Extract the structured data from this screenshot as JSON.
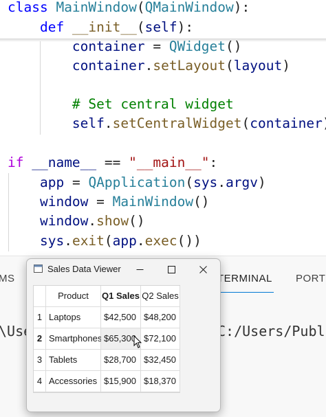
{
  "editor": {
    "lines": [
      {
        "tokens": [
          {
            "t": "class ",
            "c": "kw"
          },
          {
            "t": "MainWindow",
            "c": "cls"
          },
          {
            "t": "(",
            "c": "plain"
          },
          {
            "t": "QMainWindow",
            "c": "cls"
          },
          {
            "t": "):",
            "c": "plain"
          }
        ]
      },
      {
        "tokens": [
          {
            "t": "    ",
            "c": "plain"
          },
          {
            "t": "def ",
            "c": "kw"
          },
          {
            "t": "__init__",
            "c": "fn"
          },
          {
            "t": "(",
            "c": "plain"
          },
          {
            "t": "self",
            "c": "var"
          },
          {
            "t": "):",
            "c": "plain"
          }
        ]
      },
      {
        "tokens": [
          {
            "t": "        ",
            "c": "plain"
          },
          {
            "t": "container",
            "c": "var"
          },
          {
            "t": " = ",
            "c": "plain"
          },
          {
            "t": "QWidget",
            "c": "cls"
          },
          {
            "t": "()",
            "c": "plain"
          }
        ]
      },
      {
        "tokens": [
          {
            "t": "        ",
            "c": "plain"
          },
          {
            "t": "container",
            "c": "var"
          },
          {
            "t": ".",
            "c": "plain"
          },
          {
            "t": "setLayout",
            "c": "fn"
          },
          {
            "t": "(",
            "c": "plain"
          },
          {
            "t": "layout",
            "c": "var"
          },
          {
            "t": ")",
            "c": "plain"
          }
        ]
      },
      {
        "tokens": []
      },
      {
        "tokens": [
          {
            "t": "        ",
            "c": "plain"
          },
          {
            "t": "# Set central widget",
            "c": "cmt"
          }
        ]
      },
      {
        "tokens": [
          {
            "t": "        ",
            "c": "plain"
          },
          {
            "t": "self",
            "c": "var"
          },
          {
            "t": ".",
            "c": "plain"
          },
          {
            "t": "setCentralWidget",
            "c": "fn"
          },
          {
            "t": "(",
            "c": "plain"
          },
          {
            "t": "container",
            "c": "var"
          },
          {
            "t": ")",
            "c": "plain"
          }
        ]
      },
      {
        "tokens": []
      },
      {
        "tokens": [
          {
            "t": "if ",
            "c": "ctrl"
          },
          {
            "t": "__name__",
            "c": "var"
          },
          {
            "t": " == ",
            "c": "plain"
          },
          {
            "t": "\"__main__\"",
            "c": "str"
          },
          {
            "t": ":",
            "c": "plain"
          }
        ]
      },
      {
        "tokens": [
          {
            "t": "    ",
            "c": "plain"
          },
          {
            "t": "app",
            "c": "var"
          },
          {
            "t": " = ",
            "c": "plain"
          },
          {
            "t": "QApplication",
            "c": "cls"
          },
          {
            "t": "(",
            "c": "plain"
          },
          {
            "t": "sys",
            "c": "var"
          },
          {
            "t": ".",
            "c": "plain"
          },
          {
            "t": "argv",
            "c": "var"
          },
          {
            "t": ")",
            "c": "plain"
          }
        ]
      },
      {
        "tokens": [
          {
            "t": "    ",
            "c": "plain"
          },
          {
            "t": "window",
            "c": "var"
          },
          {
            "t": " = ",
            "c": "plain"
          },
          {
            "t": "MainWindow",
            "c": "cls"
          },
          {
            "t": "()",
            "c": "plain"
          }
        ]
      },
      {
        "tokens": [
          {
            "t": "    ",
            "c": "plain"
          },
          {
            "t": "window",
            "c": "var"
          },
          {
            "t": ".",
            "c": "plain"
          },
          {
            "t": "show",
            "c": "fn"
          },
          {
            "t": "()",
            "c": "plain"
          }
        ]
      },
      {
        "tokens": [
          {
            "t": "    ",
            "c": "plain"
          },
          {
            "t": "sys",
            "c": "var"
          },
          {
            "t": ".",
            "c": "plain"
          },
          {
            "t": "exit",
            "c": "fn"
          },
          {
            "t": "(",
            "c": "plain"
          },
          {
            "t": "app",
            "c": "var"
          },
          {
            "t": ".",
            "c": "plain"
          },
          {
            "t": "exec",
            "c": "fn"
          },
          {
            "t": "())",
            "c": "plain"
          }
        ]
      }
    ]
  },
  "panel": {
    "tabs": {
      "problems_partial": "MS",
      "terminal": "TERMINAL",
      "ports_partial": "PORTS"
    },
    "terminal_left_fragment": "\\Use",
    "terminal_prompt": "C:/Users/Public"
  },
  "dialog": {
    "title": "Sales Data Viewer",
    "icon": "qt-window-icon",
    "controls": {
      "minimize": "minimize-icon",
      "maximize": "maximize-icon",
      "close": "close-icon"
    },
    "table": {
      "headers": [
        "Product",
        "Q1 Sales",
        "Q2 Sales"
      ],
      "row_numbers": [
        "1",
        "2",
        "3",
        "4"
      ],
      "rows": [
        [
          "Laptops",
          "$42,500",
          "$48,200"
        ],
        [
          "Smartphones",
          "$65,300",
          "$72,100"
        ],
        [
          "Tablets",
          "$28,700",
          "$32,450"
        ],
        [
          "Accessories",
          "$15,900",
          "$18,370"
        ]
      ]
    }
  },
  "colors": {
    "accent": "#0078d4",
    "keyword": "#0000ff",
    "class": "#267f99",
    "function": "#795e26",
    "string": "#a31515",
    "comment": "#008000"
  }
}
